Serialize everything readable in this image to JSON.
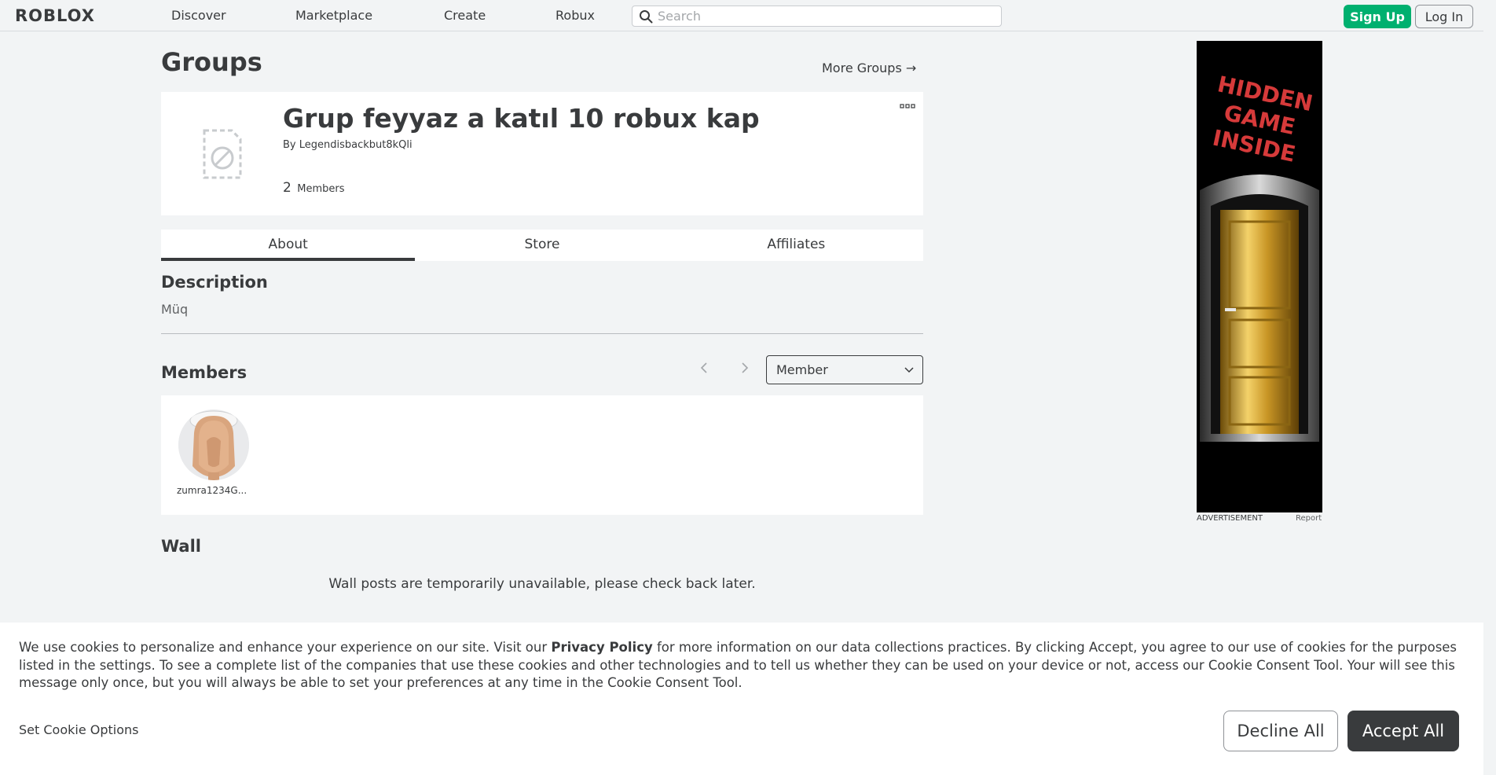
{
  "nav": {
    "logo": "ROBLOX",
    "links": [
      "Discover",
      "Marketplace",
      "Create",
      "Robux"
    ],
    "search_placeholder": "Search",
    "search_value": "",
    "signup_label": "Sign Up",
    "login_label": "Log In"
  },
  "page": {
    "title": "Groups",
    "more_groups_label": "More Groups →"
  },
  "group": {
    "name": "Grup feyyaz a katıl 10 robux kap",
    "by_label": "By",
    "owner": "Legendisbackbut8kQli",
    "member_count": "2",
    "member_count_label": "Members"
  },
  "tabs": [
    {
      "label": "About",
      "active": true
    },
    {
      "label": "Store",
      "active": false
    },
    {
      "label": "Affiliates",
      "active": false
    }
  ],
  "description": {
    "title": "Description",
    "text": "Müq"
  },
  "members": {
    "title": "Members",
    "role_selected": "Member",
    "list": [
      {
        "name": "zumra1234G..."
      }
    ]
  },
  "wall": {
    "title": "Wall",
    "message": "Wall posts are temporarily unavailable, please check back later."
  },
  "ad": {
    "headline_lines": [
      "HIDDEN",
      "GAME",
      "INSIDE"
    ],
    "label": "ADVERTISEMENT",
    "report_label": "Report"
  },
  "cookie": {
    "text_before_link": "We use cookies to personalize and enhance your experience on our site. Visit our ",
    "privacy_link": "Privacy Policy",
    "text_after_link": " for more information on our data collections practices. By clicking Accept, you agree to our use of cookies for the purposes listed in the settings. To see a complete list of the companies that use these cookies and other technologies and to tell us whether they can be used on your device or not, access our Cookie Consent Tool. Your will see this message only once, but you will always be able to set your preferences at any time in the Cookie Consent Tool.",
    "options_label": "Set Cookie Options",
    "decline_label": "Decline All",
    "accept_label": "Accept All"
  },
  "colors": {
    "accent_green": "#00b06f",
    "text_dark": "#393b3d",
    "background": "#f2f4f5"
  }
}
